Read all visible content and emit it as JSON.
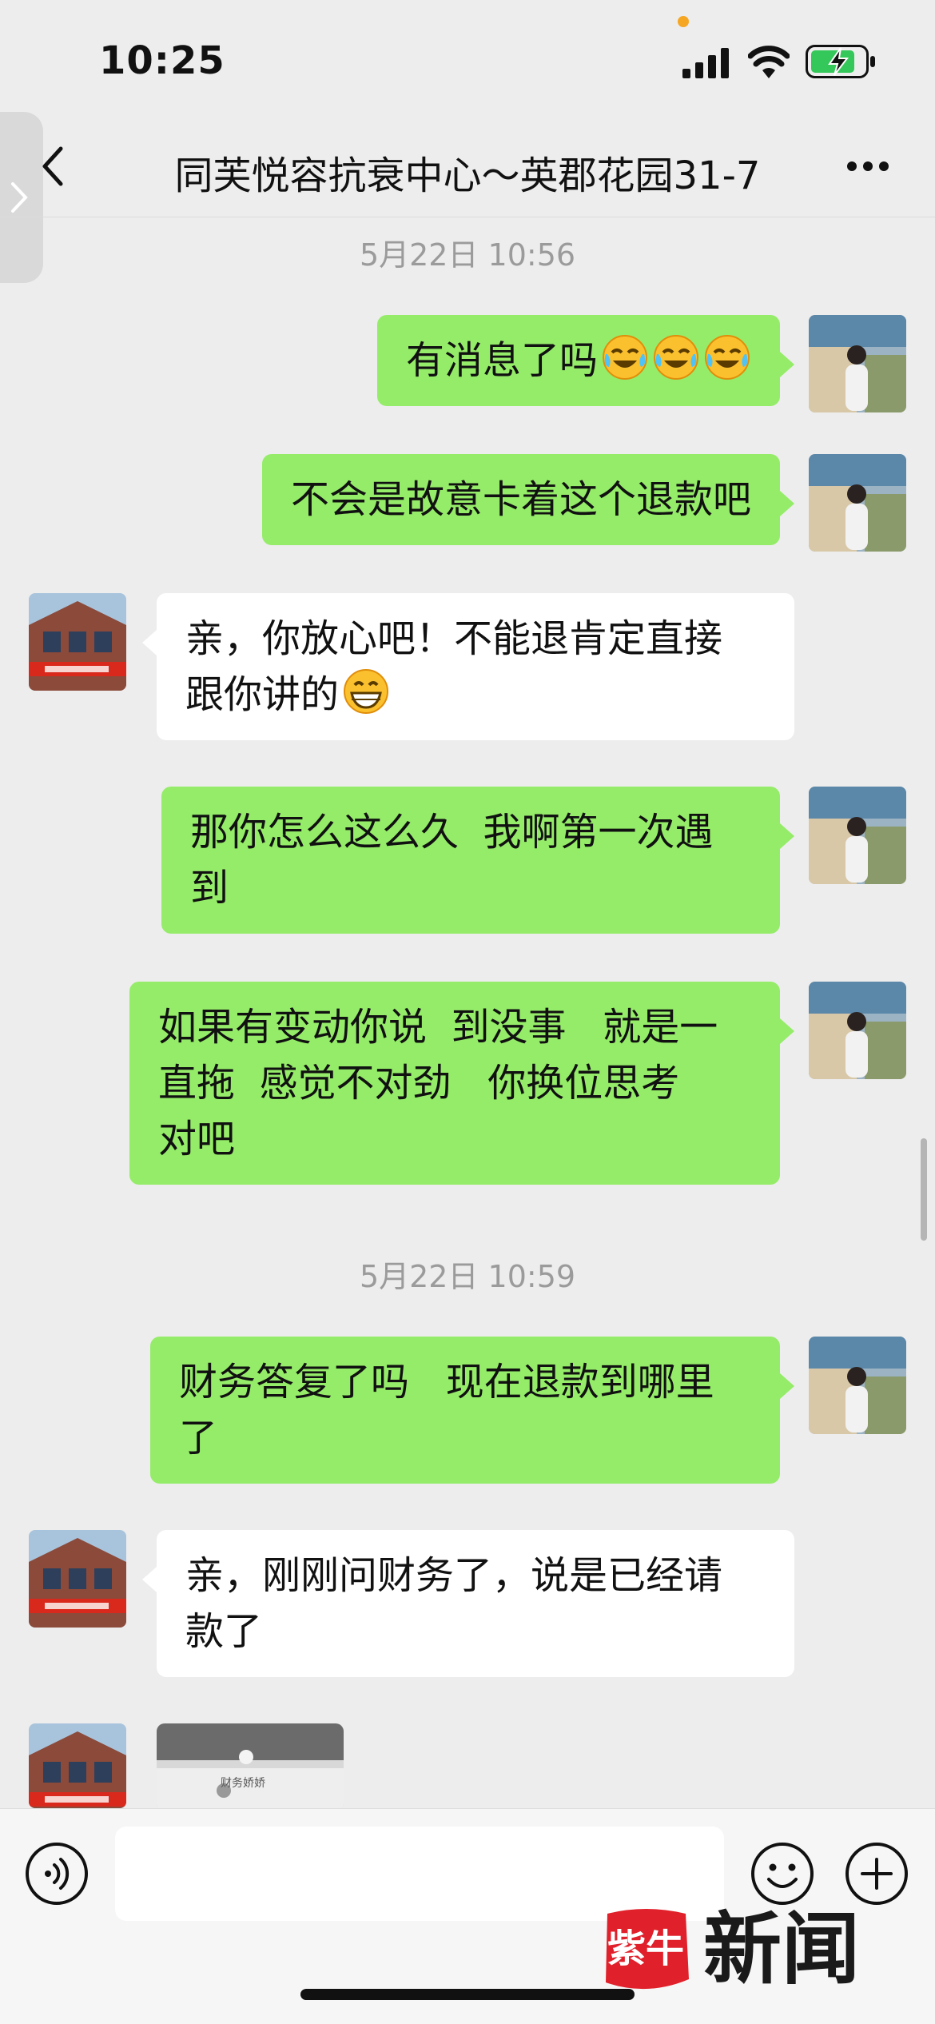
{
  "status_bar": {
    "time": "10:25"
  },
  "nav": {
    "title": "同芙悦容抗衰中心～英郡花园31-7"
  },
  "timestamps": [
    "5月22日 10:56",
    "5月22日 10:59"
  ],
  "messages": [
    {
      "sender": "me",
      "lines": [
        "有消息了吗"
      ],
      "emojis": [
        "crying-laughing-emoji",
        "crying-laughing-emoji",
        "crying-laughing-emoji"
      ]
    },
    {
      "sender": "me",
      "lines": [
        "不会是故意卡着这个退款吧"
      ]
    },
    {
      "sender": "shop",
      "lines": [
        "亲，你放心吧！不能退肯定直接",
        "跟你讲的"
      ],
      "emojis": [
        "grinning-emoji"
      ]
    },
    {
      "sender": "me",
      "lines": [
        "那你怎么这么久  我啊第一次遇",
        "到"
      ]
    },
    {
      "sender": "me",
      "lines": [
        "如果有变动你说  到没事   就是一",
        "直拖  感觉不对劲   你换位思考",
        "对吧"
      ]
    },
    {
      "sender": "me",
      "lines": [
        "财务答复了吗   现在退款到哪里",
        "了"
      ]
    },
    {
      "sender": "shop",
      "lines": [
        "亲，刚刚问财务了，说是已经请",
        "款了"
      ]
    }
  ],
  "image_message": {
    "caption": "财务娇娇"
  },
  "input": {
    "placeholder": ""
  },
  "watermark": {
    "text": "新闻",
    "logo_text": "紫牛"
  },
  "colors": {
    "my_bubble": "#95ec69",
    "their_bubble": "#ffffff",
    "background": "#ededed",
    "watermark_red": "#e0202a"
  }
}
